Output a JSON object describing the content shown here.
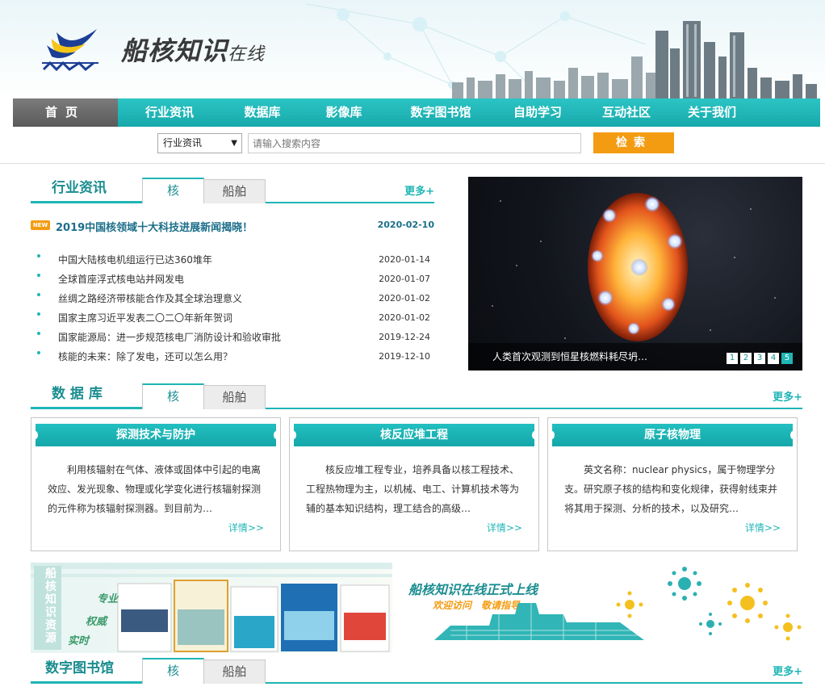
{
  "header": {
    "site_title_main": "船核知识",
    "site_title_suffix": "在线"
  },
  "nav": {
    "items": [
      {
        "label": "首页"
      },
      {
        "label": "行业资讯"
      },
      {
        "label": "数据库"
      },
      {
        "label": "影像库"
      },
      {
        "label": "数字图书馆"
      },
      {
        "label": "自助学习"
      },
      {
        "label": "互动社区"
      },
      {
        "label": "关于我们"
      }
    ]
  },
  "search": {
    "category": "行业资讯",
    "placeholder": "请输入搜索内容",
    "button": "检索"
  },
  "news": {
    "title": "行业资讯",
    "tab_active": "核",
    "tab_other": "船舶",
    "more": "更多+",
    "badge": "NEW",
    "headline": {
      "text": "2019中国核领域十大科技进展新闻揭晓！",
      "date": "2020-02-10"
    },
    "items": [
      {
        "text": "中国大陆核电机组运行已达360堆年",
        "date": "2020-01-14"
      },
      {
        "text": "全球首座浮式核电站并网发电",
        "date": "2020-01-07"
      },
      {
        "text": "丝绸之路经济带核能合作及其全球治理意义",
        "date": "2020-01-02"
      },
      {
        "text": "国家主席习近平发表二〇二〇年新年贺词",
        "date": "2020-01-02"
      },
      {
        "text": "国家能源局：进一步规范核电厂消防设计和验收审批",
        "date": "2019-12-24"
      },
      {
        "text": "核能的未来：除了发电，还可以怎么用？",
        "date": "2019-12-10"
      }
    ]
  },
  "slider": {
    "caption": "人类首次观测到恒星核燃料耗尽坍…",
    "pages": [
      "1",
      "2",
      "3",
      "4",
      "5"
    ],
    "active_page": "5"
  },
  "database": {
    "title": "数 据 库",
    "tab_active": "核",
    "tab_other": "船舶",
    "more": "更多+",
    "cards": [
      {
        "title": "探测技术与防护",
        "desc": "利用核辐射在气体、液体或固体中引起的电离效应、发光现象、物理或化学变化进行核辐射探测的元件称为核辐射探测器。到目前为…",
        "detail": "详情>>"
      },
      {
        "title": "核反应堆工程",
        "desc": "核反应堆工程专业，培养具备以核工程技术、工程热物理为主，以机械、电工、计算机技术等为辅的基本知识结构，理工结合的高级…",
        "detail": "详情>>"
      },
      {
        "title": "原子核物理",
        "desc": "英文名称：nuclear physics，属于物理学分支。研究原子核的结构和变化规律，获得射线束并将其用于探测、分析的技术，以及研究…",
        "detail": "详情>>"
      }
    ]
  },
  "banner": {
    "title": "船核知识在线正式上线",
    "subtitle": "欢迎访问　敬请指导",
    "side_text": "船核知识资源",
    "words": [
      "专业",
      "权威",
      "实时"
    ]
  },
  "library": {
    "title": "数字图书馆",
    "tab_active": "核",
    "tab_other": "船舶",
    "more": "更多+"
  },
  "colors": {
    "accent": "#1fb5b5",
    "orange": "#f39c12",
    "nav_home": "#6a6a6a"
  }
}
